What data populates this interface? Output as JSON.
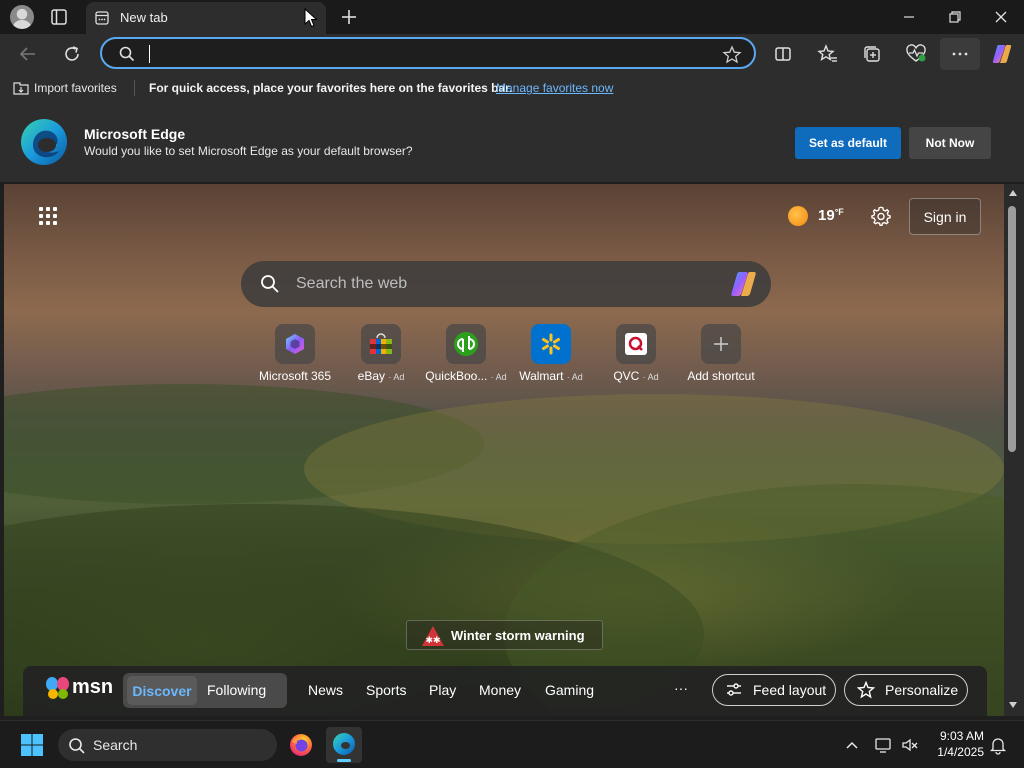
{
  "browser": {
    "tab": {
      "title": "New tab"
    },
    "address_bar": {
      "value": "",
      "placeholder": ""
    }
  },
  "favorites_bar": {
    "import_label": "Import favorites",
    "message": "For quick access, place your favorites here on the favorites bar.",
    "manage_link": "Manage favorites now"
  },
  "default_banner": {
    "app_name": "Microsoft Edge",
    "question": "Would you like to set Microsoft Edge as your default browser?",
    "primary_button": "Set as default",
    "secondary_button": "Not Now"
  },
  "new_tab_page": {
    "weather": {
      "temp": "19",
      "unit": "°F"
    },
    "sign_in": "Sign in",
    "search_placeholder": "Search the web",
    "shortcuts": [
      {
        "label": "Microsoft 365",
        "ad": ""
      },
      {
        "label": "eBay",
        "ad": "· Ad"
      },
      {
        "label": "QuickBoo...",
        "ad": "· Ad"
      },
      {
        "label": "Walmart",
        "ad": "· Ad"
      },
      {
        "label": "QVC",
        "ad": "· Ad"
      },
      {
        "label": "Add shortcut",
        "ad": ""
      }
    ],
    "alert": "Winter storm warning",
    "msn": {
      "logo": "msn",
      "tabs": [
        "Discover",
        "Following"
      ],
      "nav": [
        "News",
        "Sports",
        "Play",
        "Money",
        "Gaming"
      ],
      "more": "···",
      "feed_layout": "Feed layout",
      "personalize": "Personalize"
    }
  },
  "taskbar": {
    "search": "Search",
    "time": "9:03 AM",
    "date": "1/4/2025"
  },
  "colors": {
    "accent": "#0f6cbd",
    "link": "#6cb8ff",
    "focus_ring": "#5aa9f0"
  },
  "icons": [
    "profile-icon",
    "tab-actions-icon",
    "new-tab-icon",
    "refresh-icon",
    "back-icon",
    "search-icon",
    "favorite-star-icon",
    "split-screen-icon",
    "favorites-icon",
    "collections-icon",
    "browser-essentials-icon",
    "more-icon",
    "copilot-icon",
    "apps-grid-icon",
    "settings-gear-icon",
    "sun-icon",
    "warning-icon",
    "windows-start-icon",
    "firefox-icon",
    "edge-icon"
  ]
}
